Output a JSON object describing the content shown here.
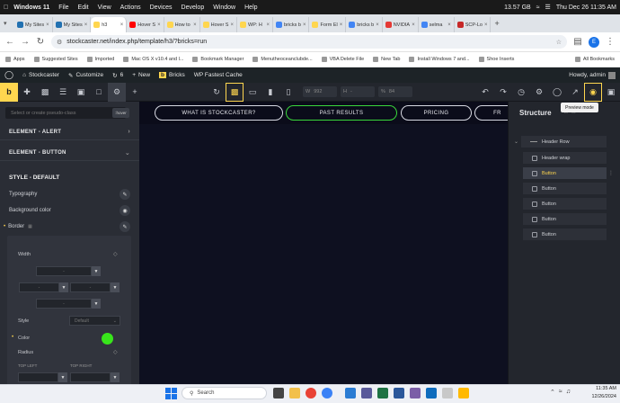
{
  "menubar": {
    "os_name": "Windows 11",
    "items": [
      "File",
      "Edit",
      "View",
      "Actions",
      "Devices",
      "Develop",
      "Window",
      "Help"
    ],
    "storage": "13.57 GB",
    "datetime": "Thu Dec 26 11:35 AM"
  },
  "browser": {
    "tabs": [
      {
        "label": "My Sites",
        "color": "#2271b1"
      },
      {
        "label": "My Sites",
        "color": "#2271b1"
      },
      {
        "label": "h3",
        "color": "#ffd64f",
        "active": true
      },
      {
        "label": "Hover S",
        "color": "#ff0000"
      },
      {
        "label": "How to",
        "color": "#ffd64f"
      },
      {
        "label": "Hover S",
        "color": "#ffd64f"
      },
      {
        "label": "WP: H",
        "color": "#ffd64f"
      },
      {
        "label": "bricks b",
        "color": "#4285f4"
      },
      {
        "label": "Form El",
        "color": "#ffd64f"
      },
      {
        "label": "bricks b",
        "color": "#4285f4"
      },
      {
        "label": "NVIDIA",
        "color": "#e53935"
      },
      {
        "label": "selma",
        "color": "#4285f4"
      },
      {
        "label": "SCP-Lo",
        "color": "#c62828"
      }
    ],
    "url": "stockcaster.net/index.php/template/h3/?bricks=run",
    "bookmarks": [
      "Apps",
      "Suggested Sites",
      "Imported",
      "Mac OS X v10.4 and l...",
      "Bookmark Manager",
      "Menutheoceanclubde...",
      "VBA Delete File",
      "New Tab",
      "Install Windows 7 and...",
      "Shoe Inserts"
    ],
    "all_bookmarks": "All Bookmarks",
    "profile_initial": "E"
  },
  "wpbar": {
    "site": "Stockcaster",
    "customize": "Customize",
    "comments": "6",
    "new": "New",
    "bricks": "Bricks",
    "cache": "WP Fastest Cache",
    "howdy": "Howdy, admin"
  },
  "toolbar": {
    "width_label": "W",
    "width_value": "992",
    "height_label": "H",
    "height_value": "-",
    "zoom_label": "%",
    "zoom_value": "84",
    "preview_tooltip": "Preview mode"
  },
  "leftpanel": {
    "search_placeholder": "Select or create pseudo-class",
    "hover_tag": ":hover",
    "sections": [
      "ELEMENT - ALERT",
      "ELEMENT - BUTTON"
    ],
    "style_title": "STYLE - DEFAULT",
    "rows": [
      "Typography",
      "Background color",
      "Border"
    ],
    "border": {
      "width_label": "Width",
      "style_label": "Style",
      "style_value": "Default",
      "color_label": "Color",
      "radius_label": "Radius",
      "top_left": "TOP LEFT",
      "top_right": "TOP RIGHT",
      "dash": "-"
    }
  },
  "canvas": {
    "nav": [
      {
        "label": "WHAT IS STOCKCASTER?",
        "active": false
      },
      {
        "label": "PAST RESULTS",
        "active": true
      },
      {
        "label": "PRICING",
        "active": false
      },
      {
        "label": "FR",
        "active": false
      }
    ]
  },
  "structure": {
    "title": "Structure",
    "items": [
      {
        "label": "Header Row",
        "level": 0
      },
      {
        "label": "Header wrap",
        "level": 1
      },
      {
        "label": "Button",
        "level": 1,
        "selected": true
      },
      {
        "label": "Button",
        "level": 1
      },
      {
        "label": "Button",
        "level": 1
      },
      {
        "label": "Button",
        "level": 1
      },
      {
        "label": "Button",
        "level": 1
      }
    ]
  },
  "taskbar": {
    "search": "Search",
    "time": "11:35 AM",
    "date": "12/26/2024"
  }
}
